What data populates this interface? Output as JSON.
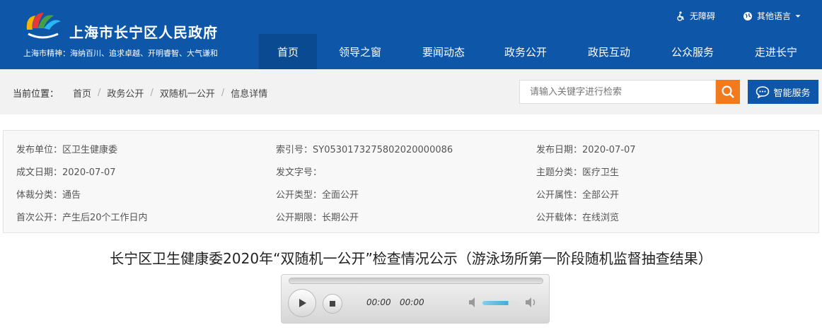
{
  "header": {
    "site_title": "上海市长宁区人民政府",
    "slogan": "上海市精神：海纳百川、追求卓越、开明睿智、大气谦和",
    "accessibility": "无障碍",
    "language": "其他语言",
    "nav": [
      "首页",
      "领导之窗",
      "要闻动态",
      "政务公开",
      "政民互动",
      "公众服务",
      "走进长宁"
    ]
  },
  "breadcrumb": {
    "lead": "当前位置：",
    "items": [
      "首页",
      "政务公开",
      "双随机一公开",
      "信息详情"
    ]
  },
  "search": {
    "placeholder": "请输入关键字进行检索"
  },
  "smart_service": "智能服务",
  "meta": {
    "publisher": "发布单位：区卫生健康委",
    "index_no": "索引号：SY0530173275802020000086",
    "publish_date": "发布日期：2020-07-07",
    "created_date": "成文日期：2020-07-07",
    "doc_no": "发文字号：",
    "topic": "主题分类：医疗卫生",
    "genre": "体裁分类：通告",
    "open_type": "公开类型：全面公开",
    "open_attr": "公开属性：全部公开",
    "first_open": "首次公开：产生后20个工作日内",
    "open_period": "公开期限：长期公开",
    "open_carrier": "公开载体：在线浏览"
  },
  "title": "长宁区卫生健康委2020年“双随机一公开”检查情况公示（游泳场所第一阶段随机监督抽查结果）",
  "player": {
    "current_time": "00:00",
    "duration": "00:00",
    "volume": 0.7
  }
}
